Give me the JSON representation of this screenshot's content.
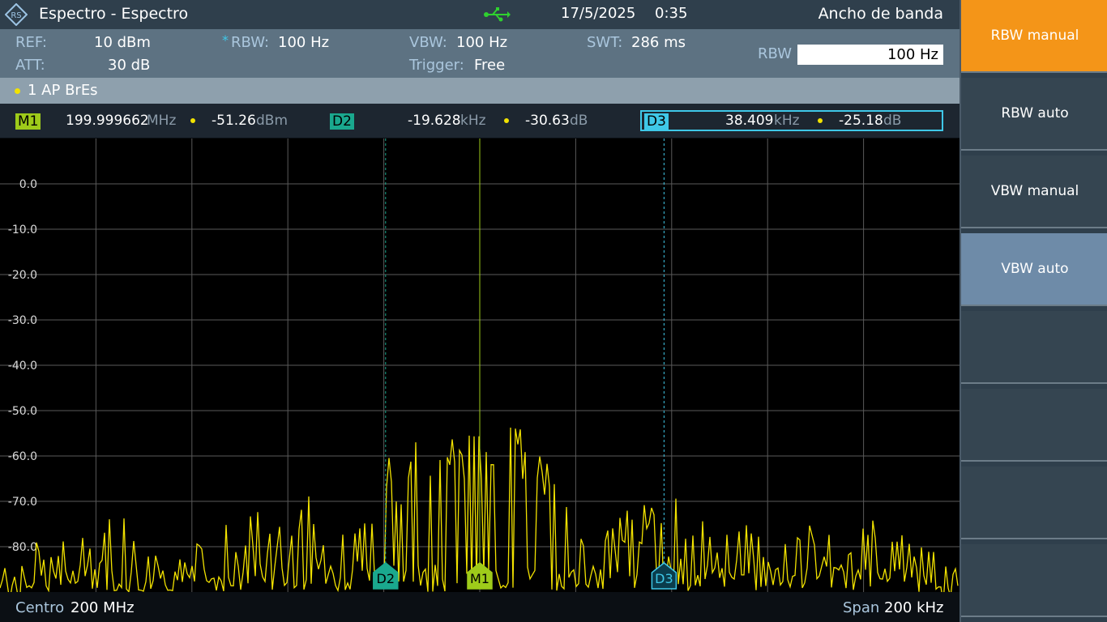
{
  "titlebar": {
    "title": "Espectro - Espectro",
    "date": "17/5/2025",
    "time": "0:35",
    "icons": [
      "rs-logo-icon",
      "usb-icon"
    ]
  },
  "panel": {
    "title": "Ancho de banda",
    "rbw_label": "RBW",
    "rbw_value": "100 Hz"
  },
  "settings": {
    "ref_label": "REF:",
    "ref_value": "10 dBm",
    "att_label": "ATT:",
    "att_value": "30 dB",
    "rbw_marker": "*",
    "rbw_label": "RBW:",
    "rbw_value": "100 Hz",
    "vbw_label": "VBW:",
    "vbw_value": "100 Hz",
    "trigger_label": "Trigger:",
    "trigger_value": "Free",
    "swt_label": "SWT:",
    "swt_value": "286 ms"
  },
  "trace": {
    "label": "1 AP  BrEs",
    "color": "#f2e200"
  },
  "markers": {
    "m1": {
      "name": "M1",
      "freq": "199.999662",
      "freq_unit": "MHz",
      "level": "-51.26",
      "level_unit": "dBm",
      "color": "#9ecb1a"
    },
    "d2": {
      "name": "D2",
      "freq": "-19.628",
      "freq_unit": "kHz",
      "level": "-30.63",
      "level_unit": "dB",
      "color": "#1aa88e"
    },
    "d3": {
      "name": "D3",
      "freq": "38.409",
      "freq_unit": "kHz",
      "level": "-25.18",
      "level_unit": "dB",
      "color": "#3fc8e8"
    }
  },
  "footer": {
    "center_label": "Centro",
    "center_value": "200 MHz",
    "span_label": "Span",
    "span_value": "200 kHz"
  },
  "softkeys": [
    {
      "label": "RBW manual",
      "state": "active"
    },
    {
      "label": "RBW auto",
      "state": "normal"
    },
    {
      "label": "VBW manual",
      "state": "normal"
    },
    {
      "label": "VBW auto",
      "state": "selected"
    },
    {
      "label": "",
      "state": "empty"
    },
    {
      "label": "",
      "state": "empty"
    },
    {
      "label": "",
      "state": "empty"
    },
    {
      "label": "",
      "state": "empty"
    }
  ],
  "chart_data": {
    "type": "line",
    "ylabel": "",
    "ylim": [
      -90,
      10
    ],
    "yticks": [
      "0.0",
      "-10.0",
      "-20.0",
      "-30.0",
      "-40.0",
      "-50.0",
      "-60.0",
      "-70.0",
      "-80.0"
    ],
    "x_center_mhz": 200,
    "x_span_khz": 200,
    "grid": true,
    "series": [
      {
        "color": "#f2e200",
        "peak_dbm": -51.26,
        "noise_floor_dbm": -90
      }
    ],
    "markers": [
      {
        "name": "D2",
        "offset_khz": -19.628
      },
      {
        "name": "M1",
        "offset_khz": 0
      },
      {
        "name": "D3",
        "offset_khz": 38.409
      }
    ]
  }
}
